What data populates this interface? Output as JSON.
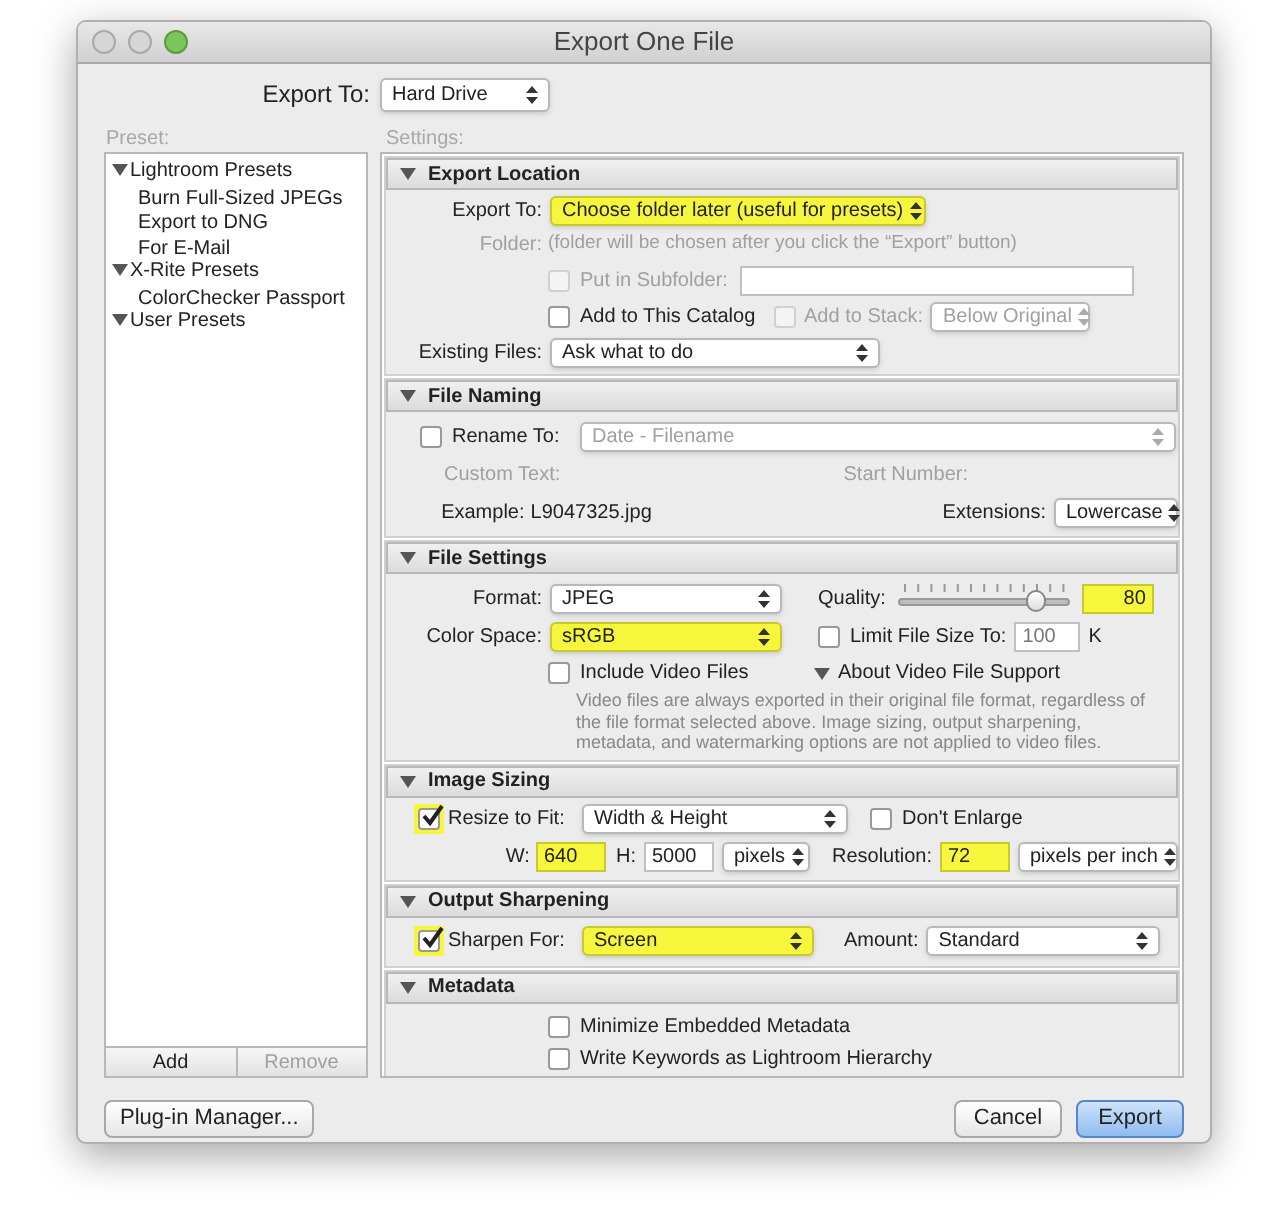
{
  "window": {
    "title": "Export One File"
  },
  "export_to": {
    "label": "Export To:",
    "value": "Hard Drive"
  },
  "preset": {
    "label": "Preset:",
    "tree": [
      {
        "label": "Lightroom Presets",
        "expanded": true,
        "children": [
          {
            "label": "Burn Full-Sized JPEGs"
          },
          {
            "label": "Export to DNG"
          },
          {
            "label": "For E-Mail"
          }
        ]
      },
      {
        "label": "X-Rite Presets",
        "expanded": true,
        "children": [
          {
            "label": "ColorChecker Passport"
          }
        ]
      },
      {
        "label": "User Presets",
        "expanded": true
      }
    ],
    "buttons": [
      {
        "label": "Add",
        "disabled": false
      },
      {
        "label": "Remove",
        "disabled": true
      }
    ]
  },
  "settings": {
    "label": "Settings:",
    "sections": [
      {
        "kind": "export_location",
        "title": "Export Location",
        "expanded": true,
        "fields": {
          "export_to": {
            "label": "Export To:",
            "value": "Choose folder later (useful for presets)",
            "highlighted": true
          },
          "folder": {
            "label": "Folder:",
            "value": "(folder will be chosen after you click the “Export” button)",
            "disabled": true
          },
          "subfolder": {
            "label": "Put in Subfolder:",
            "checked": false,
            "disabled": true
          },
          "add_to_catalog": {
            "label": "Add to This Catalog",
            "checked": false,
            "disabled": false
          },
          "add_to_stack": {
            "label": "Add to Stack:",
            "checked": false,
            "disabled": true
          },
          "stack_position": {
            "value": "Below Original",
            "disabled": true
          },
          "existing_files": {
            "label": "Existing Files:",
            "value": "Ask what to do"
          }
        }
      },
      {
        "kind": "file_naming",
        "title": "File Naming",
        "expanded": true,
        "fields": {
          "rename_to": {
            "label": "Rename To:",
            "checked": false
          },
          "template": {
            "value": "Date - Filename",
            "disabled": true
          },
          "custom_text": {
            "label": "Custom Text:",
            "disabled": true
          },
          "start_number": {
            "label": "Start Number:",
            "disabled": true
          },
          "example": {
            "label": "Example:",
            "value": "L9047325.jpg"
          },
          "extensions": {
            "label": "Extensions:",
            "value": "Lowercase"
          }
        }
      },
      {
        "kind": "file_settings",
        "title": "File Settings",
        "expanded": true,
        "fields": {
          "format": {
            "label": "Format:",
            "value": "JPEG",
            "highlighted": false
          },
          "quality": {
            "label": "Quality:",
            "level": 0.8,
            "value": "80",
            "highlighted": true
          },
          "color_space": {
            "label": "Color Space:",
            "value": "sRGB",
            "highlighted": true
          },
          "limit_file_size": {
            "label": "Limit File Size To:",
            "checked": false,
            "value": "100",
            "unit": "K"
          },
          "include_video": {
            "label": "Include Video Files",
            "checked": false
          },
          "about_video": {
            "label": "About Video File Support",
            "expanded": true
          },
          "note": "Video files are always exported in their original file format, regardless of the file format selected above. Image sizing, output sharpening, metadata, and watermarking options are not applied to video files."
        }
      },
      {
        "kind": "image_sizing",
        "title": "Image Sizing",
        "expanded": true,
        "fields": {
          "resize_to_fit": {
            "label": "Resize to Fit:",
            "checked": true,
            "highlighted": true
          },
          "resize_mode": {
            "value": "Width & Height"
          },
          "dont_enlarge": {
            "label": "Don't Enlarge",
            "checked": false
          },
          "width": {
            "label": "W:",
            "value": "640",
            "highlighted": true
          },
          "height": {
            "label": "H:",
            "value": "5000",
            "highlighted": false
          },
          "units": {
            "value": "pixels"
          },
          "resolution": {
            "label": "Resolution:",
            "value": "72",
            "highlighted": true
          },
          "resolution_unit": {
            "value": "pixels per inch"
          }
        }
      },
      {
        "kind": "output_sharpening",
        "title": "Output Sharpening",
        "expanded": true,
        "fields": {
          "sharpen_for": {
            "label": "Sharpen For:",
            "checked": true,
            "highlighted": true,
            "value": "Screen",
            "value_highlighted": true
          },
          "amount": {
            "label": "Amount:",
            "value": "Standard"
          }
        }
      },
      {
        "kind": "metadata",
        "title": "Metadata",
        "expanded": true,
        "fields": {
          "options": [
            {
              "label": "Minimize Embedded Metadata",
              "checked": false
            },
            {
              "label": "Write Keywords as Lightroom Hierarchy",
              "checked": false
            }
          ]
        }
      }
    ]
  },
  "footer": {
    "plugin_manager": "Plug-in Manager...",
    "buttons": [
      {
        "label": "Cancel",
        "default": false
      },
      {
        "label": "Export",
        "default": true
      }
    ]
  }
}
